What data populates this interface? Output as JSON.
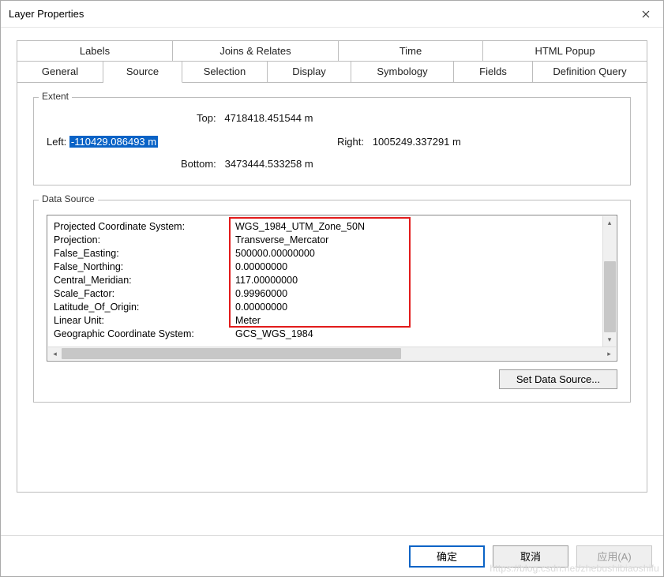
{
  "window": {
    "title": "Layer Properties"
  },
  "tabs": {
    "row1": [
      {
        "label": "Labels"
      },
      {
        "label": "Joins & Relates"
      },
      {
        "label": "Time"
      },
      {
        "label": "HTML Popup"
      }
    ],
    "row2": [
      {
        "label": "General"
      },
      {
        "label": "Source",
        "active": true
      },
      {
        "label": "Selection"
      },
      {
        "label": "Display"
      },
      {
        "label": "Symbology"
      },
      {
        "label": "Fields"
      },
      {
        "label": "Definition Query"
      }
    ]
  },
  "extent": {
    "title": "Extent",
    "top_label": "Top:",
    "top_value": "4718418.451544 m",
    "left_label": "Left:",
    "left_value": "-110429.086493 m",
    "right_label": "Right:",
    "right_value": "1005249.337291 m",
    "bottom_label": "Bottom:",
    "bottom_value": "3473444.533258 m"
  },
  "data_source": {
    "title": "Data Source",
    "rows": [
      {
        "k": "Projected Coordinate System:",
        "v": "WGS_1984_UTM_Zone_50N"
      },
      {
        "k": "Projection:",
        "v": "Transverse_Mercator"
      },
      {
        "k": "False_Easting:",
        "v": "500000.00000000"
      },
      {
        "k": "False_Northing:",
        "v": "0.00000000"
      },
      {
        "k": "Central_Meridian:",
        "v": "117.00000000"
      },
      {
        "k": "Scale_Factor:",
        "v": "0.99960000"
      },
      {
        "k": "Latitude_Of_Origin:",
        "v": "0.00000000"
      },
      {
        "k": "Linear Unit:",
        "v": "Meter"
      }
    ],
    "gap_row": " ",
    "gcs_row": {
      "k": "Geographic Coordinate System:",
      "v": "GCS_WGS_1984"
    },
    "set_button": "Set Data Source..."
  },
  "footer": {
    "ok": "确定",
    "cancel": "取消",
    "apply": "应用(A)"
  },
  "watermark": "https://blog.csdn.net/zhebushibiaoshifu"
}
